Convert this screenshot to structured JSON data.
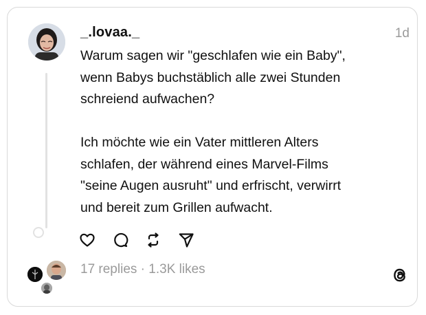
{
  "post": {
    "username": "_.lovaa._",
    "timestamp": "1d",
    "text": "Warum sagen wir \"geschlafen wie ein Baby\",\nwenn Babys buchstäblich alle zwei Stunden\nschreiend aufwachen?\n\nIch möchte wie ein Vater mittleren Alters\nschlafen, der während eines Marvel-Films\n\"seine Augen ausruht\" und erfrischt, verwirrt\nund bereit zum Grillen aufwacht."
  },
  "actions": {
    "icons": [
      "heart-icon",
      "comment-icon",
      "repost-icon",
      "share-icon"
    ]
  },
  "footer": {
    "replies": "17 replies",
    "separator": "·",
    "likes": "1.3K likes"
  },
  "brand": {
    "logo": "threads-logo-icon"
  }
}
